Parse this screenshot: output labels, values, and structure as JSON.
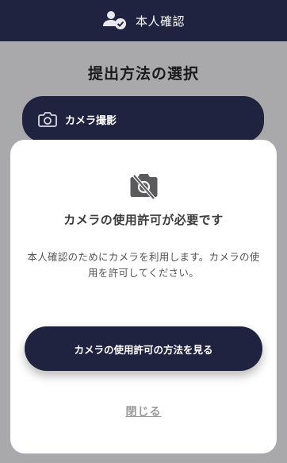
{
  "header": {
    "title": "本人確認",
    "icon": "user-check-icon"
  },
  "page": {
    "title": "提出方法の選択",
    "camera_option": {
      "label": "カメラ撮影",
      "icon": "camera-icon"
    }
  },
  "modal": {
    "icon": "camera-off-icon",
    "heading": "カメラの使用許可が必要です",
    "message": "本人確認のためにカメラを利用します。カメラの使用を許可してください。",
    "primary_button": "カメラの使用許可の方法を見る",
    "close_link": "閉じる"
  },
  "colors": {
    "navy": "#1f2340",
    "overlay": "#a9a9ab",
    "modal_bg": "#ffffff",
    "icon_gray": "#5b5b5d"
  }
}
